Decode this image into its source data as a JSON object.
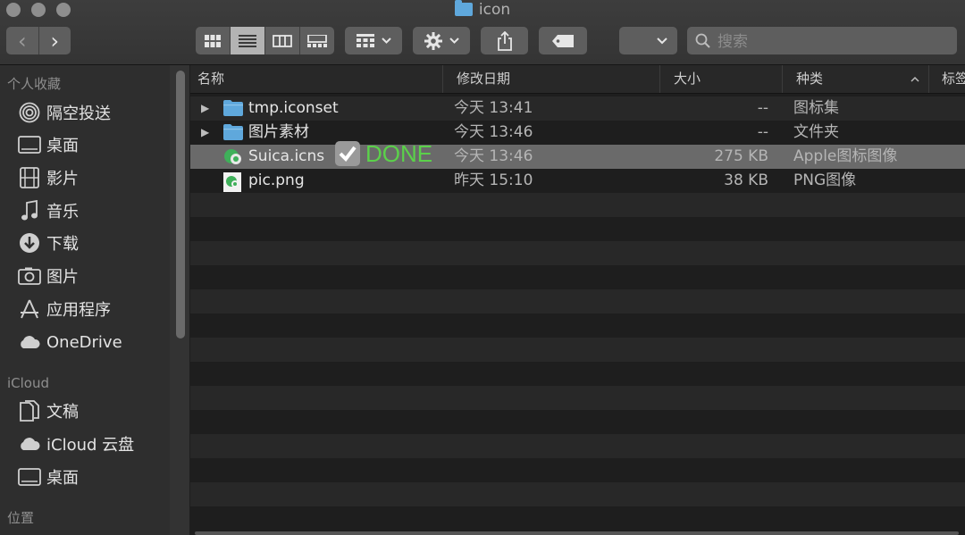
{
  "window": {
    "title": "icon"
  },
  "toolbar": {
    "nav_back": "‹",
    "nav_forward": "›",
    "search_placeholder": "搜索"
  },
  "sidebar": {
    "sections": [
      {
        "title": "个人收藏"
      },
      {
        "title": "iCloud"
      },
      {
        "title": "位置"
      }
    ],
    "items": [
      {
        "label": "隔空投送",
        "icon": "airdrop-icon"
      },
      {
        "label": "桌面",
        "icon": "desktop-icon"
      },
      {
        "label": "影片",
        "icon": "movies-icon"
      },
      {
        "label": "音乐",
        "icon": "music-icon"
      },
      {
        "label": "下载",
        "icon": "downloads-icon"
      },
      {
        "label": "图片",
        "icon": "pictures-icon"
      },
      {
        "label": "应用程序",
        "icon": "applications-icon"
      },
      {
        "label": "OneDrive",
        "icon": "cloud-icon"
      },
      {
        "label": "文稿",
        "icon": "documents-icon"
      },
      {
        "label": "iCloud 云盘",
        "icon": "icloud-drive-icon"
      },
      {
        "label": "桌面",
        "icon": "desktop-icon"
      }
    ]
  },
  "columns": {
    "name": "名称",
    "modified": "修改日期",
    "size": "大小",
    "kind": "种类",
    "tags": "标签"
  },
  "files": [
    {
      "name": "tmp.iconset",
      "modified": "今天 13:41",
      "size": "--",
      "kind": "图标集",
      "type": "folder",
      "expandable": true
    },
    {
      "name": "图片素材",
      "modified": "今天 13:46",
      "size": "--",
      "kind": "文件夹",
      "type": "folder",
      "expandable": true
    },
    {
      "name": "Suica.icns",
      "modified": "今天 13:46",
      "size": "275 KB",
      "kind": "Apple图标图像",
      "type": "icns",
      "selected": true
    },
    {
      "name": "pic.png",
      "modified": "昨天 15:10",
      "size": "38 KB",
      "kind": "PNG图像",
      "type": "png"
    }
  ],
  "overlay": {
    "done_label": "DONE"
  },
  "colors": {
    "accent_green": "#5bd14a",
    "folder_blue": "#5fa8dc"
  }
}
